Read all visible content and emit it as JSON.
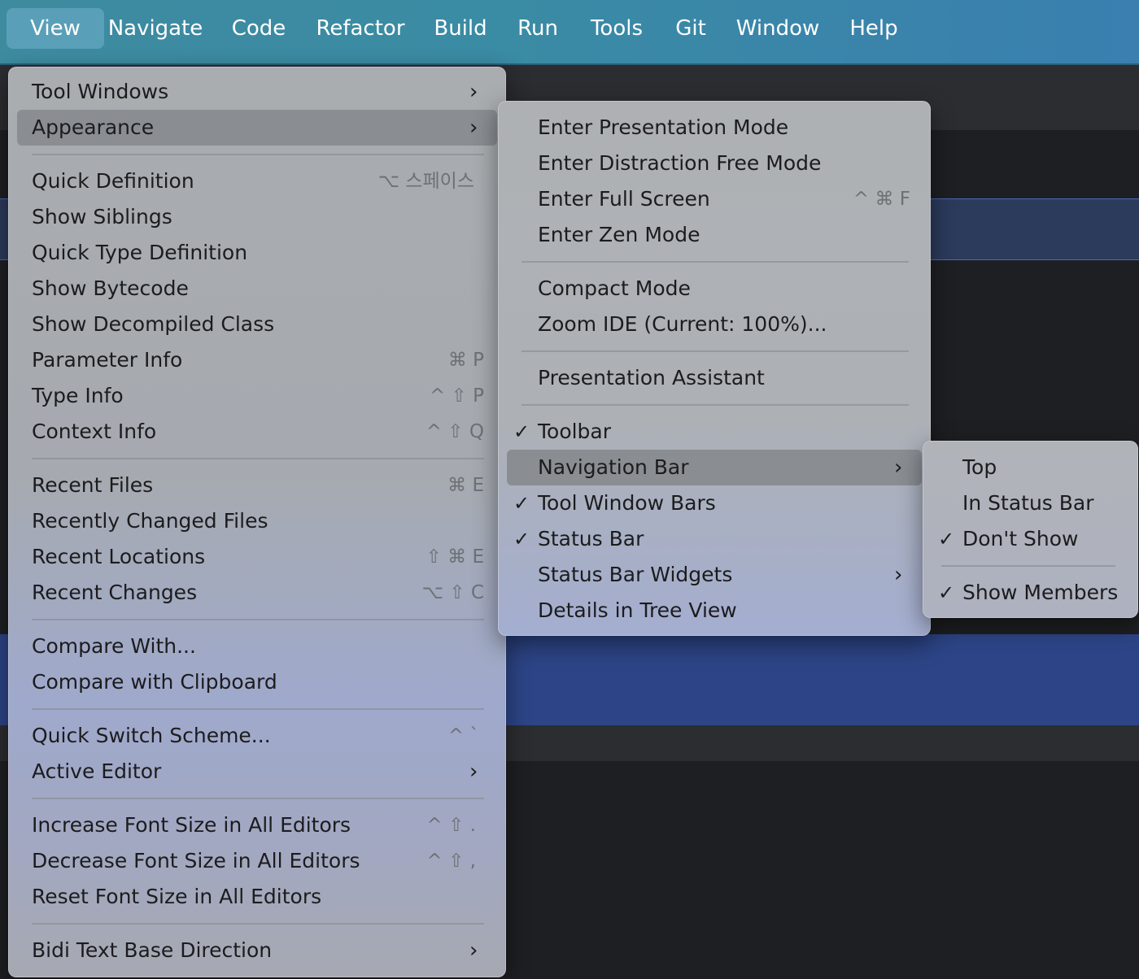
{
  "menubar": {
    "items": [
      "View",
      "Navigate",
      "Code",
      "Refactor",
      "Build",
      "Run",
      "Tools",
      "Git",
      "Window",
      "Help"
    ]
  },
  "view_menu": {
    "tool_windows": "Tool Windows",
    "appearance": "Appearance",
    "quick_definition": "Quick Definition",
    "quick_definition_shortcut": "⌥ 스페이스",
    "show_siblings": "Show Siblings",
    "quick_type_definition": "Quick Type Definition",
    "show_bytecode": "Show Bytecode",
    "show_decompiled_class": "Show Decompiled Class",
    "parameter_info": "Parameter Info",
    "parameter_info_shortcut": "⌘ P",
    "type_info": "Type Info",
    "type_info_shortcut": "^ ⇧ P",
    "context_info": "Context Info",
    "context_info_shortcut": "^ ⇧ Q",
    "recent_files": "Recent Files",
    "recent_files_shortcut": "⌘ E",
    "recently_changed_files": "Recently Changed Files",
    "recent_locations": "Recent Locations",
    "recent_locations_shortcut": "⇧ ⌘ E",
    "recent_changes": "Recent Changes",
    "recent_changes_shortcut": "⌥ ⇧ C",
    "compare_with": "Compare With...",
    "compare_with_clipboard": "Compare with Clipboard",
    "quick_switch_scheme": "Quick Switch Scheme...",
    "quick_switch_scheme_shortcut": "^ `",
    "active_editor": "Active Editor",
    "increase_font": "Increase Font Size in All Editors",
    "increase_font_shortcut": "^ ⇧ .",
    "decrease_font": "Decrease Font Size in All Editors",
    "decrease_font_shortcut": "^ ⇧ ,",
    "reset_font": "Reset Font Size in All Editors",
    "bidi": "Bidi Text Base Direction"
  },
  "appearance_menu": {
    "presentation_mode": "Enter Presentation Mode",
    "distraction_free": "Enter Distraction Free Mode",
    "full_screen": "Enter Full Screen",
    "full_screen_shortcut": "^ ⌘ F",
    "zen_mode": "Enter Zen Mode",
    "compact_mode": "Compact Mode",
    "zoom_ide": "Zoom IDE (Current: 100%)...",
    "presentation_assistant": "Presentation Assistant",
    "toolbar": "Toolbar",
    "navigation_bar": "Navigation Bar",
    "tool_window_bars": "Tool Window Bars",
    "status_bar": "Status Bar",
    "status_bar_widgets": "Status Bar Widgets",
    "details_in_tree_view": "Details in Tree View"
  },
  "navbar_menu": {
    "top": "Top",
    "in_status_bar": "In Status Bar",
    "dont_show": "Don't Show",
    "show_members": "Show Members"
  },
  "colors": {
    "menubar_bg": "#3e8ba0",
    "menu_bg": "#a9adb0",
    "highlight": "#8a8e93",
    "editor_bg": "#1e1f22",
    "selection_blue": "#2d4587"
  }
}
